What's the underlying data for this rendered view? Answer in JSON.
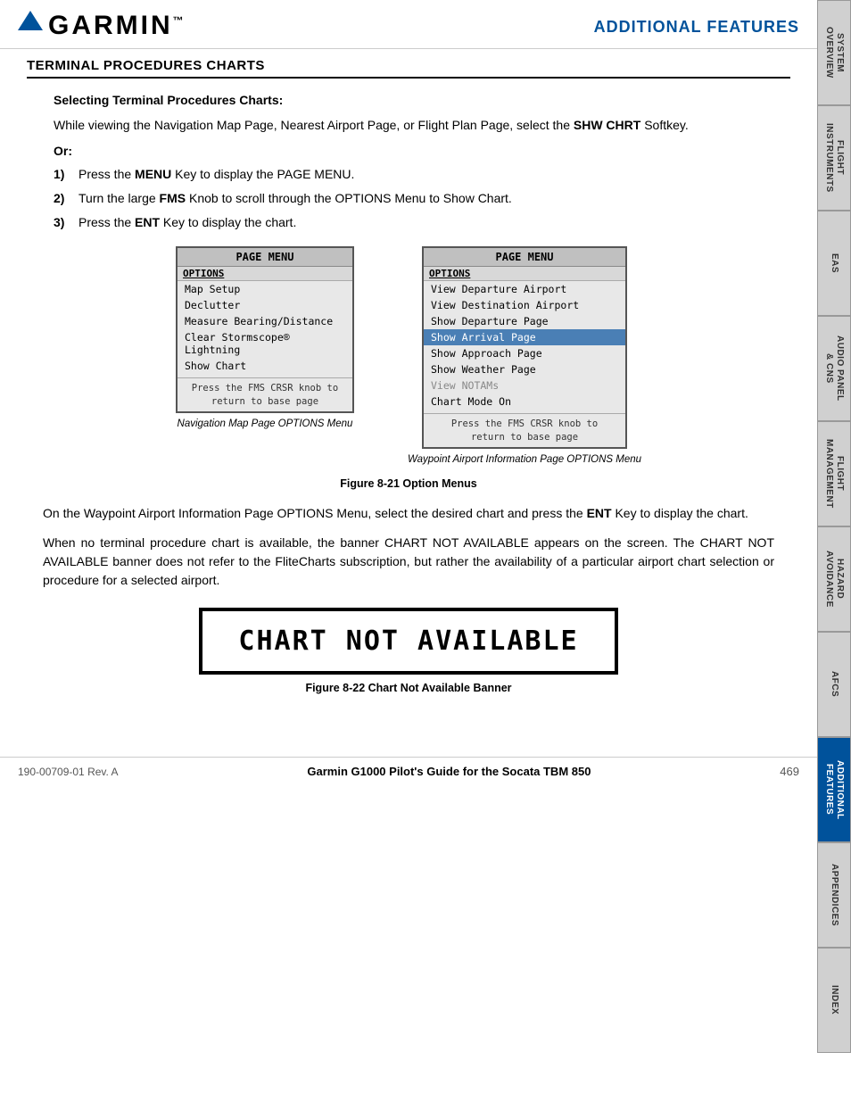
{
  "header": {
    "logo_text": "GARMIN",
    "logo_tm": "™",
    "section_title": "ADDITIONAL FEATURES"
  },
  "sidebar": {
    "tabs": [
      {
        "id": "system-overview",
        "label": "SYSTEM\nOVERVIEW",
        "active": false
      },
      {
        "id": "flight-instruments",
        "label": "FLIGHT\nINSTRUMENTS",
        "active": false
      },
      {
        "id": "eas",
        "label": "EAS",
        "active": false
      },
      {
        "id": "audio-panel",
        "label": "AUDIO PANEL\n& CNS",
        "active": false
      },
      {
        "id": "flight-management",
        "label": "FLIGHT\nMANAGEMENT",
        "active": false
      },
      {
        "id": "hazard-avoidance",
        "label": "HAZARD\nAVOIDANCE",
        "active": false
      },
      {
        "id": "afcs",
        "label": "AFCS",
        "active": false
      },
      {
        "id": "additional-features",
        "label": "ADDITIONAL\nFEATURES",
        "active": true
      },
      {
        "id": "appendices",
        "label": "APPENDICES",
        "active": false
      },
      {
        "id": "index",
        "label": "INDEX",
        "active": false
      }
    ]
  },
  "section": {
    "title": "TERMINAL PROCEDURES CHARTS",
    "subsection_title": "Selecting Terminal Procedures Charts:",
    "intro_para": "While viewing the Navigation Map Page, Nearest Airport Page, or Flight Plan Page, select the SHW CHRT Softkey.",
    "shw_chrt_bold": "SHW CHRT",
    "or_label": "Or:",
    "steps": [
      {
        "num": "1)",
        "text": "Press the MENU Key to display the PAGE MENU.",
        "bold_part": "MENU"
      },
      {
        "num": "2)",
        "text": "Turn the large FMS Knob to scroll through the OPTIONS Menu to Show Chart.",
        "bold_part": "FMS"
      },
      {
        "num": "3)",
        "text": "Press the ENT Key to display the chart.",
        "bold_part": "ENT"
      }
    ]
  },
  "menu_left": {
    "title": "PAGE MENU",
    "section": "OPTIONS",
    "items": [
      {
        "label": "Map Setup",
        "highlighted": false,
        "grayed": false
      },
      {
        "label": "Declutter",
        "highlighted": false,
        "grayed": false
      },
      {
        "label": "Measure Bearing/Distance",
        "highlighted": false,
        "grayed": false
      },
      {
        "label": "Clear Stormscope® Lightning",
        "highlighted": false,
        "grayed": false
      },
      {
        "label": "Show Chart",
        "highlighted": false,
        "grayed": false
      }
    ],
    "footer": "Press the FMS CRSR knob to\nreturn to base page",
    "caption": "Navigation Map Page OPTIONS Menu"
  },
  "menu_right": {
    "title": "PAGE MENU",
    "section": "OPTIONS",
    "items": [
      {
        "label": "View Departure Airport",
        "highlighted": false,
        "grayed": false
      },
      {
        "label": "View Destination Airport",
        "highlighted": false,
        "grayed": false
      },
      {
        "label": "Show Departure Page",
        "highlighted": false,
        "grayed": false
      },
      {
        "label": "Show Arrival Page",
        "highlighted": true,
        "grayed": false
      },
      {
        "label": "Show Approach Page",
        "highlighted": false,
        "grayed": false
      },
      {
        "label": "Show Weather Page",
        "highlighted": false,
        "grayed": false
      },
      {
        "label": "View NOTAMs",
        "highlighted": false,
        "grayed": true
      },
      {
        "label": "Chart Mode On",
        "highlighted": false,
        "grayed": false
      }
    ],
    "footer": "Press the FMS CRSR knob to\nreturn to base page",
    "caption": "Waypoint Airport Information Page OPTIONS Menu"
  },
  "figure_21_caption": "Figure 8-21  Option Menus",
  "body_para_1": "On the Waypoint Airport Information Page OPTIONS Menu, select the desired chart and press the ENT Key to display the chart.",
  "body_para_1_bold": "ENT",
  "body_para_2": "When no terminal procedure chart is available, the banner CHART NOT AVAILABLE appears on the screen. The CHART NOT AVAILABLE banner does not refer to the FliteCharts subscription, but rather the availability of a particular airport chart selection or procedure for a selected airport.",
  "chart_banner_text": "CHART NOT AVAILABLE",
  "figure_22_caption": "Figure 8-22  Chart Not Available Banner",
  "footer": {
    "left": "190-00709-01  Rev. A",
    "center": "Garmin G1000 Pilot's Guide for the Socata TBM 850",
    "right": "469"
  }
}
